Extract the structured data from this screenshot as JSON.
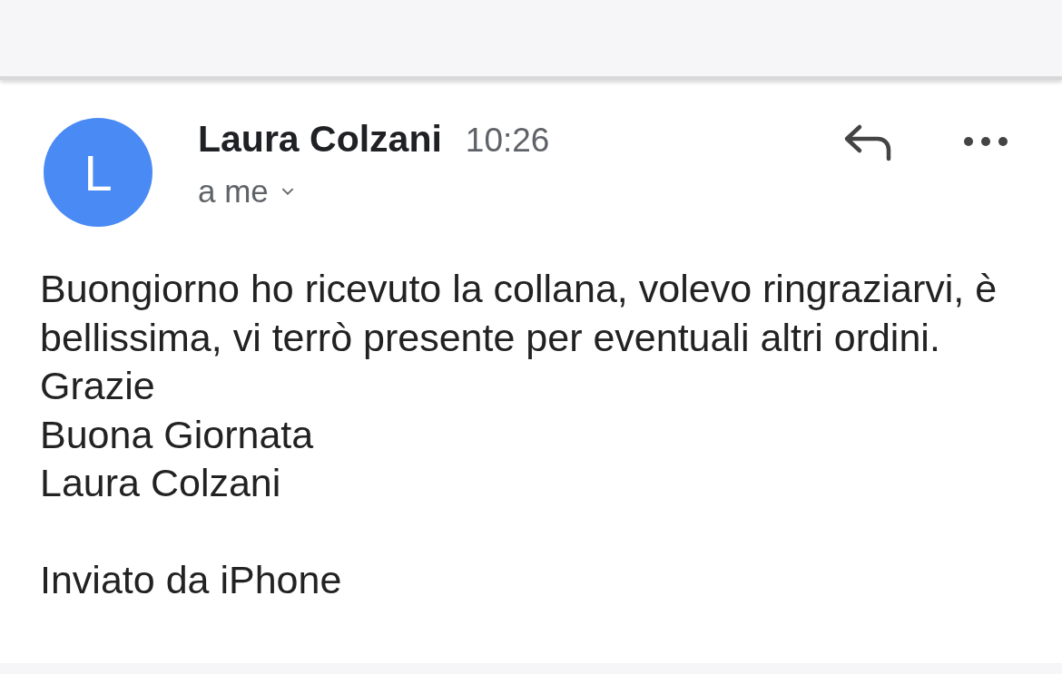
{
  "message": {
    "avatar_letter": "L",
    "sender": "Laura Colzani",
    "time": "10:26",
    "recipient": "a me",
    "paragraphs": [
      [
        "Buongiorno ho ricevuto la collana, volevo ringraziarvi, è",
        "bellissima, vi terrò presente per eventuali altri ordini.",
        "Grazie",
        "Buona Giornata",
        "Laura Colzani"
      ],
      [
        "Inviato da iPhone"
      ]
    ]
  }
}
